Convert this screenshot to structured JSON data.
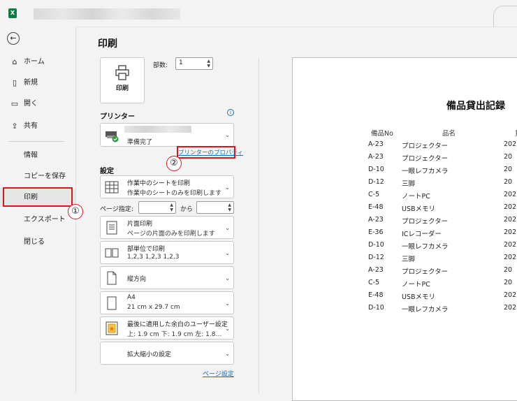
{
  "titlebar": {
    "app_icon": "X"
  },
  "nav": {
    "back_icon": "←",
    "items": [
      {
        "icon": "⌂",
        "label": "ホーム"
      },
      {
        "icon": "▯",
        "label": "新規"
      },
      {
        "icon": "▭",
        "label": "開く"
      },
      {
        "icon": "⇪",
        "label": "共有"
      }
    ],
    "sub_items": [
      "情報",
      "コピーを保存",
      "印刷",
      "エクスポート",
      "閉じる"
    ]
  },
  "callouts": {
    "c1": "①",
    "c2": "②"
  },
  "panel": {
    "title": "印刷",
    "print_button": "印刷",
    "copies_label": "部数:",
    "copies_value": "1",
    "printer_section": "プリンター",
    "printer_status": "準備完了",
    "printer_properties_link": "プリンターのプロパティ",
    "settings_section": "設定",
    "pages_label": "ページ指定:",
    "pages_to": "から",
    "page_setup_link": "ページ設定",
    "settings": [
      {
        "icon": "sheet-grid-icon",
        "line1": "作業中のシートを印刷",
        "line2": "作業中のシートのみを印刷します"
      },
      {
        "icon": "one-sided-icon",
        "line1": "片面印刷",
        "line2": "ページの片面のみを印刷します"
      },
      {
        "icon": "collate-icon",
        "line1": "部単位で印刷",
        "line2": "1,2,3    1,2,3    1,2,3"
      },
      {
        "icon": "portrait-icon",
        "line1": "縦方向",
        "line2": ""
      },
      {
        "icon": "paper-size-icon",
        "line1": "A4",
        "line2": "21 cm x 29.7 cm"
      },
      {
        "icon": "margins-icon",
        "line1": "最後に適用した余白のユーザー設定",
        "line2": "上: 1.9 cm 下: 1.9 cm 左: 1.8…"
      },
      {
        "icon": "scaling-icon",
        "line1": "拡大縮小の設定",
        "line2": ""
      }
    ]
  },
  "preview": {
    "title": "備品貸出記録",
    "headers": [
      "備品No",
      "品名",
      "貸"
    ],
    "rows": [
      [
        "A-23",
        "プロジェクター",
        "202"
      ],
      [
        "A-23",
        "プロジェクター",
        "20"
      ],
      [
        "D-10",
        "一眼レフカメラ",
        "20"
      ],
      [
        "D-12",
        "三脚",
        "20"
      ],
      [
        "C-5",
        "ノートPC",
        "202"
      ],
      [
        "E-48",
        "USBメモリ",
        "202"
      ],
      [
        "A-23",
        "プロジェクター",
        "202"
      ],
      [
        "E-36",
        "ICレコーダー",
        "202"
      ],
      [
        "D-10",
        "一眼レフカメラ",
        "202"
      ],
      [
        "D-12",
        "三脚",
        "202"
      ],
      [
        "A-23",
        "プロジェクター",
        "20"
      ],
      [
        "C-5",
        "ノートPC",
        "20"
      ],
      [
        "E-48",
        "USBメモリ",
        "202"
      ],
      [
        "D-10",
        "一眼レフカメラ",
        "202"
      ]
    ]
  },
  "colors": {
    "accent_red": "#d9161d",
    "link_blue": "#1a6fb3",
    "excel_green": "#107c41"
  }
}
